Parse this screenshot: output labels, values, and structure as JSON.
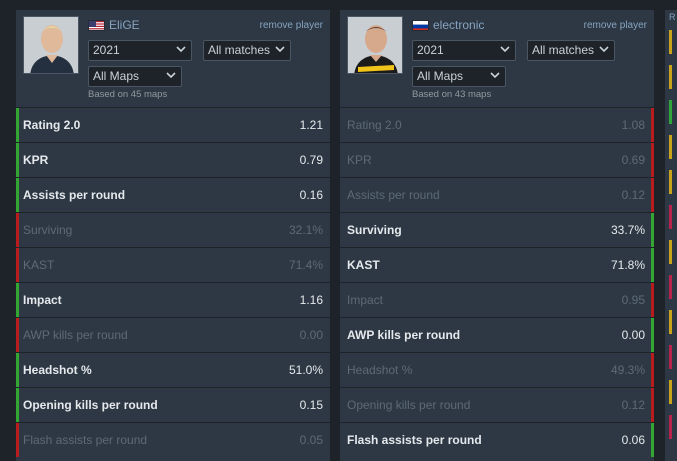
{
  "players": [
    {
      "name": "EliGE",
      "flag": "us",
      "remove_label": "remove player",
      "year": "2021",
      "matches": "All matches",
      "maps": "All Maps",
      "based_on": "Based on 45 maps",
      "stats": [
        {
          "label": "Rating 2.0",
          "value": "1.21",
          "status": "good"
        },
        {
          "label": "KPR",
          "value": "0.79",
          "status": "good"
        },
        {
          "label": "Assists per round",
          "value": "0.16",
          "status": "good"
        },
        {
          "label": "Surviving",
          "value": "32.1%",
          "status": "bad"
        },
        {
          "label": "KAST",
          "value": "71.4%",
          "status": "bad"
        },
        {
          "label": "Impact",
          "value": "1.16",
          "status": "good"
        },
        {
          "label": "AWP kills per round",
          "value": "0.00",
          "status": "bad"
        },
        {
          "label": "Headshot %",
          "value": "51.0%",
          "status": "good"
        },
        {
          "label": "Opening kills per round",
          "value": "0.15",
          "status": "good"
        },
        {
          "label": "Flash assists per round",
          "value": "0.05",
          "status": "bad"
        }
      ]
    },
    {
      "name": "electronic",
      "flag": "ru",
      "remove_label": "remove player",
      "year": "2021",
      "matches": "All matches",
      "maps": "All Maps",
      "based_on": "Based on 43 maps",
      "stats": [
        {
          "label": "Rating 2.0",
          "value": "1.08",
          "status": "bad"
        },
        {
          "label": "KPR",
          "value": "0.69",
          "status": "bad"
        },
        {
          "label": "Assists per round",
          "value": "0.12",
          "status": "bad"
        },
        {
          "label": "Surviving",
          "value": "33.7%",
          "status": "good"
        },
        {
          "label": "KAST",
          "value": "71.8%",
          "status": "good"
        },
        {
          "label": "Impact",
          "value": "0.95",
          "status": "bad"
        },
        {
          "label": "AWP kills per round",
          "value": "0.00",
          "status": "good"
        },
        {
          "label": "Headshot %",
          "value": "49.3%",
          "status": "bad"
        },
        {
          "label": "Opening kills per round",
          "value": "0.12",
          "status": "bad"
        },
        {
          "label": "Flash assists per round",
          "value": "0.06",
          "status": "good"
        }
      ]
    }
  ],
  "third_column_label": "R",
  "third_column_bars": [
    "#c8a31c",
    "#c8a31c",
    "#2fa53a",
    "#c8a31c",
    "#c8a31c",
    "#b8234d",
    "#c8a31c",
    "#b8234d",
    "#c8a31c",
    "#b8234d",
    "#c8a31c",
    "#b8234d"
  ],
  "colors": {
    "good": "#33a532",
    "bad": "#b91c1c",
    "background": "#1e2329",
    "panel": "#2d3844",
    "link": "#87a3bf"
  }
}
